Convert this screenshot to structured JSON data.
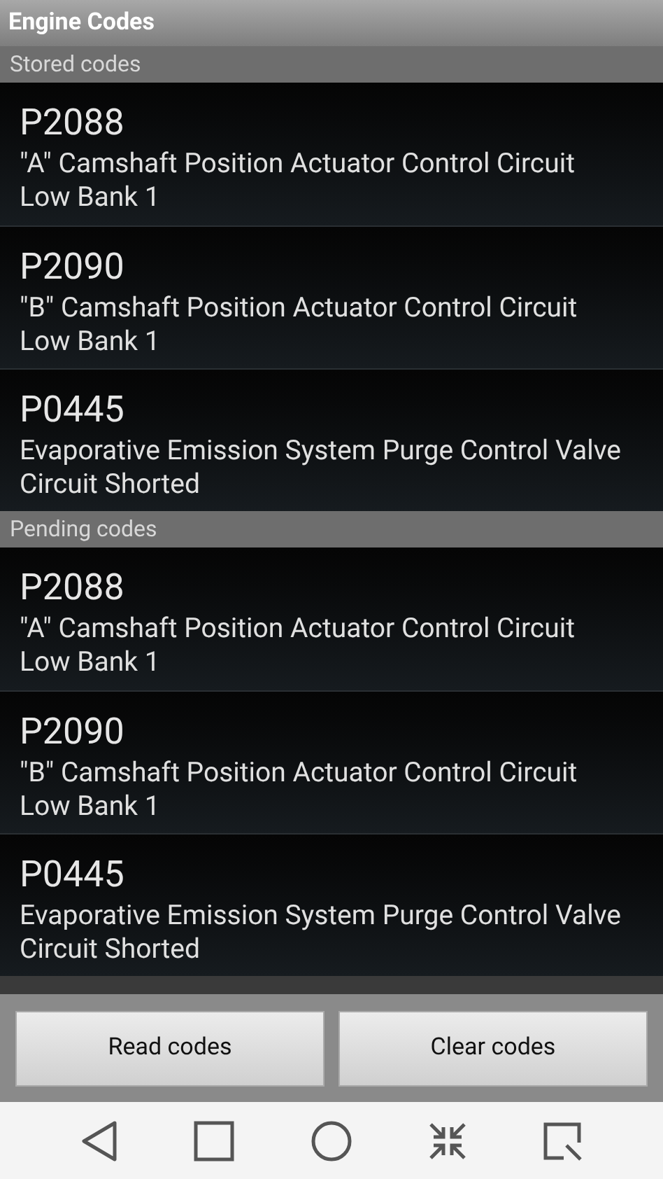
{
  "title": "Engine Codes",
  "sections": [
    {
      "header": "Stored codes",
      "codes": [
        {
          "code": "P2088",
          "description": "\"A\" Camshaft Position Actuator Control Circuit Low Bank 1"
        },
        {
          "code": "P2090",
          "description": "\"B\" Camshaft Position Actuator Control Circuit Low Bank 1"
        },
        {
          "code": "P0445",
          "description": "Evaporative Emission System Purge Control Valve Circuit Shorted"
        }
      ]
    },
    {
      "header": "Pending codes",
      "codes": [
        {
          "code": "P2088",
          "description": "\"A\" Camshaft Position Actuator Control Circuit Low Bank 1"
        },
        {
          "code": "P2090",
          "description": "\"B\" Camshaft Position Actuator Control Circuit Low Bank 1"
        },
        {
          "code": "P0445",
          "description": "Evaporative Emission System Purge Control Valve Circuit Shorted"
        }
      ]
    }
  ],
  "buttons": [
    "Read codes",
    "Clear codes"
  ],
  "nav": [
    {
      "kind": "back"
    },
    {
      "kind": "recents"
    },
    {
      "kind": "home"
    },
    {
      "kind": "shrink"
    },
    {
      "kind": "capture"
    }
  ]
}
